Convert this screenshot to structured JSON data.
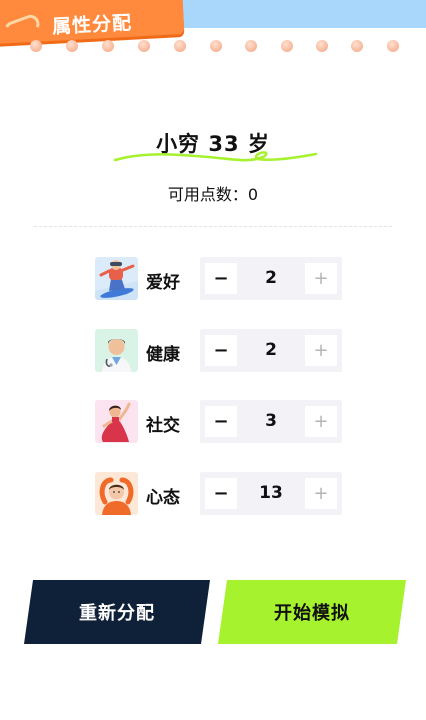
{
  "header": {
    "title": "属性分配"
  },
  "character": {
    "name_age": "小穷 33 岁"
  },
  "points": {
    "label": "可用点数：",
    "value": "0"
  },
  "attributes": [
    {
      "label": "爱好",
      "value": "2",
      "minus": "−",
      "plus": "+",
      "icon": "snowboarder-icon"
    },
    {
      "label": "健康",
      "value": "2",
      "minus": "−",
      "plus": "+",
      "icon": "doctor-icon"
    },
    {
      "label": "社交",
      "value": "3",
      "minus": "−",
      "plus": "+",
      "icon": "dancer-icon"
    },
    {
      "label": "心态",
      "value": "13",
      "minus": "−",
      "plus": "+",
      "icon": "ok-gesture-person-icon"
    }
  ],
  "actions": {
    "reset": "重新分配",
    "start": "开始模拟"
  },
  "colors": {
    "header_tag": "#ff8a3d",
    "top_band": "#a9d6fb",
    "reset_button": "#0f2138",
    "start_button": "#a6f22e",
    "squiggle": "#a6f22e"
  }
}
